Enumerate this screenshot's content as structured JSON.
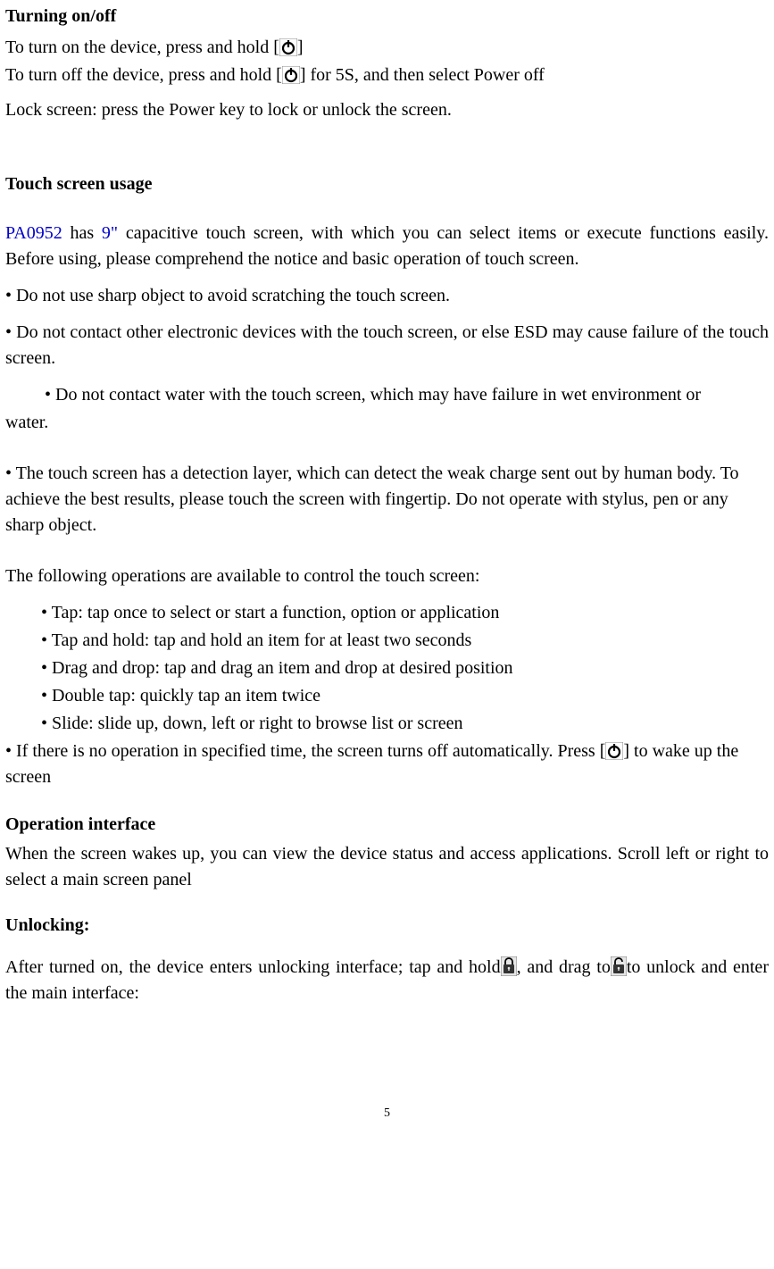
{
  "heading_turning": "Turning on/off",
  "turning_on_pre": "To turn on the device, press and hold [",
  "turning_on_post": "]",
  "turning_off_pre": "To turn off the device, press and hold [",
  "turning_off_post": "] for 5S, and then select Power off",
  "lock_screen": "Lock screen: press the Power key to lock or unlock the screen.",
  "heading_touch": "Touch screen usage",
  "touch_intro_model": "PA0952",
  "touch_intro_has": " has ",
  "touch_intro_size": "9\"",
  "touch_intro_rest": " capacitive touch screen, with which you can select items or execute functions easily. Before using, please comprehend the notice and basic operation of touch screen.",
  "bullet_sharp": "• Do not use sharp object to avoid scratching the touch screen.",
  "bullet_esd": "• Do not contact other electronic devices with the touch screen, or else ESD may cause failure of the touch screen.",
  "bullet_water_line1": "• Do not contact water with the touch screen, which may have failure in wet environment or",
  "bullet_water_line2": "water.",
  "bullet_detection": "• The touch screen has a detection layer, which can detect the weak charge sent out by human body. To achieve the best results, please touch the screen with fingertip. Do not operate with stylus, pen or any sharp object.",
  "ops_intro": "The following operations are available to control the touch screen:",
  "ops_tap": "• Tap: tap once to select or start a function, option or application",
  "ops_taphold": "• Tap and hold: tap and hold an item for at least two seconds",
  "ops_drag": "• Drag and drop: tap and drag an item and drop at desired position",
  "ops_double": "• Double tap: quickly tap an item twice",
  "ops_slide": "• Slide: slide up, down, left or right to browse list or screen",
  "auto_off_pre": "• If there is no operation in specified time, the screen turns off automatically. Press [",
  "auto_off_post": "] to wake up the screen",
  "heading_op_interface": "Operation interface",
  "op_interface_text": "When the screen wakes up, you can view the device status and access applications. Scroll left or right to select a main screen panel",
  "heading_unlocking": "Unlocking:",
  "unlock_pre": "After turned on, the device enters unlocking interface; tap and hold",
  "unlock_mid": ", and drag to",
  "unlock_post": "to unlock and enter the main interface:",
  "page_number": "5"
}
